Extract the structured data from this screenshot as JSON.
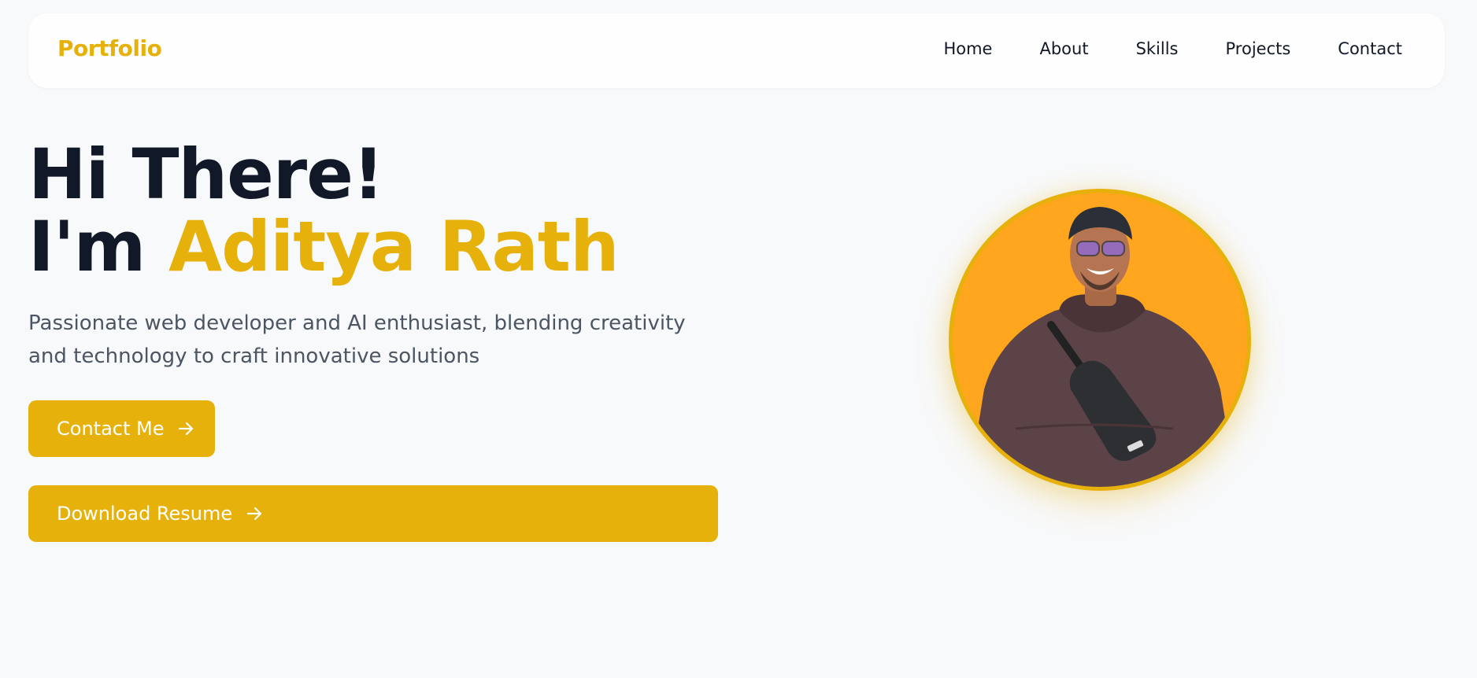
{
  "nav": {
    "brand": "Portfolio",
    "links": [
      "Home",
      "About",
      "Skills",
      "Projects",
      "Contact"
    ]
  },
  "hero": {
    "greeting": "Hi There!",
    "intro_prefix": "I'm ",
    "name": "Aditya Rath",
    "description": "Passionate web developer and AI enthusiast, blending creativity and technology to craft innovative solutions",
    "contact_button": "Contact Me",
    "resume_button": "Download Resume"
  },
  "colors": {
    "accent": "#e6b10a",
    "text_dark": "#111827",
    "text_muted": "#4b5563",
    "background": "#f8f9fa",
    "avatar_background": "#ffa51e"
  },
  "icons": {
    "button_arrow": "arrow-right-icon",
    "profile_image": "profile-photo"
  }
}
